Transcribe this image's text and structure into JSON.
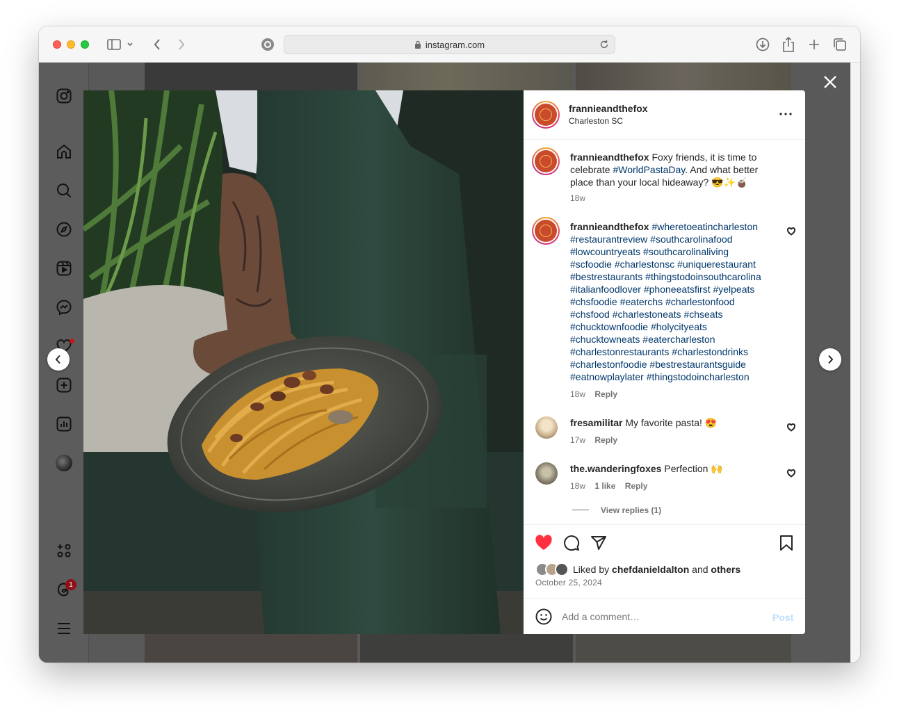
{
  "browser": {
    "url": "instagram.com"
  },
  "sidebar": {
    "items": [
      {
        "name": "instagram-logo-icon"
      },
      {
        "name": "home-icon"
      },
      {
        "name": "search-icon"
      },
      {
        "name": "explore-icon"
      },
      {
        "name": "reels-icon"
      },
      {
        "name": "messenger-icon"
      },
      {
        "name": "notifications-heart-icon"
      },
      {
        "name": "create-icon"
      },
      {
        "name": "dashboard-icon"
      },
      {
        "name": "profile-avatar"
      },
      {
        "name": "more-apps-icon"
      },
      {
        "name": "threads-icon"
      },
      {
        "name": "menu-icon"
      }
    ],
    "threads_badge": "1"
  },
  "post": {
    "username": "frannieandthefox",
    "location": "Charleston SC",
    "caption": {
      "username": "frannieandthefox",
      "text_before": " Foxy friends, it is time to celebrate ",
      "hashtag": "#WorldPastaDay",
      "text_after": ". And what better place than your local hideaway? 😎✨🧉",
      "time": "18w"
    },
    "comments": [
      {
        "username": "frannieandthefox",
        "lines": [
          " #wheretoeatincharleston",
          "#restaurantreview #southcarolinafood",
          "#lowcountryeats #southcarolinaliving",
          "#scfoodie #charlestonsc #uniquerestaurant",
          "#bestrestaurants #thingstodoinsouthcarolina",
          "#italianfoodlover #phoneeatsfirst #yelpeats",
          "#chsfoodie #eaterchs #charlestonfood",
          "#chsfood #charlestoneats #chseats",
          "#chucktownfoodie #holycityeats",
          "#chucktowneats #eatercharleston",
          "#charlestonrestaurants #charlestondrinks",
          "#charlestonfoodie #bestrestaurantsguide",
          "#eatnowplaylater #thingstodoincharleston"
        ],
        "time": "18w",
        "reply": "Reply"
      },
      {
        "username": "fresamilitar",
        "text": " My favorite pasta! 😍",
        "time": "17w",
        "reply": "Reply"
      },
      {
        "username": "the.wanderingfoxes",
        "text": " Perfection 🙌",
        "time": "18w",
        "likes": "1 like",
        "reply": "Reply",
        "view_replies": "View replies (1)"
      }
    ],
    "liked_by_prefix": "Liked by ",
    "liked_by_user": "chefdanieldalton",
    "liked_by_mid": " and ",
    "liked_by_others": "others",
    "date": "October 25, 2024",
    "comment_placeholder": "Add a comment…",
    "post_button": "Post",
    "colors": {
      "like_red": "#ff3040",
      "hashtag_blue": "#00376b",
      "post_button_disabled": "#c0dffd"
    }
  }
}
